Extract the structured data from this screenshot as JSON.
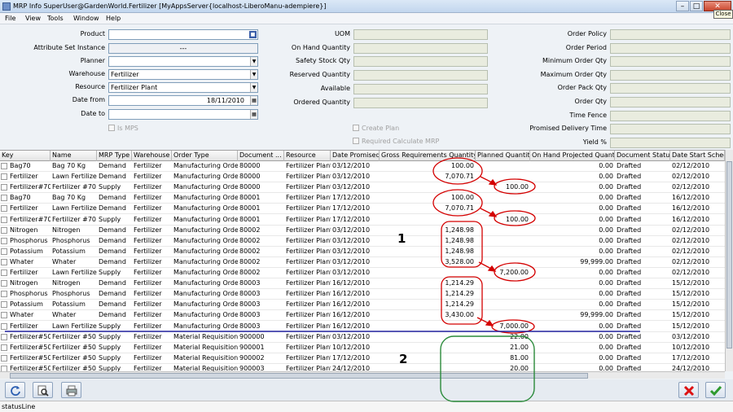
{
  "window": {
    "title": "MRP Info  SuperUser@GardenWorld.Fertilizer [MyAppsServer{localhost-LiberoManu-adempiere}]",
    "close_tooltip": "Close"
  },
  "menu": [
    "File",
    "View",
    "Tools",
    "Window",
    "Help"
  ],
  "form": {
    "left": [
      {
        "label": "Product",
        "value": "",
        "kind": "pick"
      },
      {
        "label": "Attribute Set Instance",
        "value": "---",
        "kind": "center"
      },
      {
        "label": "Planner",
        "value": "",
        "kind": "dropdown"
      },
      {
        "label": "Warehouse",
        "value": "Fertilizer",
        "kind": "dropdown"
      },
      {
        "label": "Resource",
        "value": "Fertilizer Plant",
        "kind": "dropdown"
      },
      {
        "label": "Date from",
        "value": "18/11/2010",
        "kind": "date"
      },
      {
        "label": "Date to",
        "value": "",
        "kind": "date"
      }
    ],
    "is_mps_label": "Is MPS",
    "middle": [
      {
        "label": "UOM"
      },
      {
        "label": "On Hand Quantity"
      },
      {
        "label": "Safety Stock Qty"
      },
      {
        "label": "Reserved Quantity"
      },
      {
        "label": "Available"
      },
      {
        "label": "Ordered Quantity"
      }
    ],
    "create_plan_label": "Create Plan",
    "required_calc_label": "Required Calculate MRP",
    "right": [
      {
        "label": "Order Policy"
      },
      {
        "label": "Order Period"
      },
      {
        "label": "Minimum Order Qty"
      },
      {
        "label": "Maximum Order Qty"
      },
      {
        "label": "Order Pack Qty"
      },
      {
        "label": "Order Qty"
      },
      {
        "label": "Time Fence"
      },
      {
        "label": "Promised Delivery Time"
      },
      {
        "label": "Yield %"
      }
    ]
  },
  "table": {
    "columns": [
      "Key",
      "Name",
      "MRP Type",
      "Warehouse",
      "Order Type",
      "Document ...",
      "Resource",
      "Date Promised",
      "Gross Requirements Quantity",
      "Planned Quantity",
      "On Hand Projected Quantity",
      "Document Status",
      "Date Start Schedule"
    ],
    "rows": [
      [
        "Bag70",
        "Bag 70 Kg",
        "Demand",
        "Fertilizer",
        "Manufacturing Order",
        "80000",
        "Fertilizer Plant",
        "03/12/2010",
        "100.00",
        "",
        "0.00",
        "Drafted",
        "02/12/2010"
      ],
      [
        "Fertilizer",
        "Lawn Fertilizer",
        "Demand",
        "Fertilizer",
        "Manufacturing Order",
        "80000",
        "Fertilizer Plant",
        "03/12/2010",
        "7,070.71",
        "",
        "0.00",
        "Drafted",
        "02/12/2010"
      ],
      [
        "Fertilizer#70",
        "Fertilizer #70",
        "Supply",
        "Fertilizer",
        "Manufacturing Order",
        "80000",
        "Fertilizer Plant",
        "03/12/2010",
        "",
        "100.00",
        "0.00",
        "Drafted",
        "02/12/2010"
      ],
      [
        "Bag70",
        "Bag 70 Kg",
        "Demand",
        "Fertilizer",
        "Manufacturing Order",
        "80001",
        "Fertilizer Plant",
        "17/12/2010",
        "100.00",
        "",
        "0.00",
        "Drafted",
        "16/12/2010"
      ],
      [
        "Fertilizer",
        "Lawn Fertilizer",
        "Demand",
        "Fertilizer",
        "Manufacturing Order",
        "80001",
        "Fertilizer Plant",
        "17/12/2010",
        "7,070.71",
        "",
        "0.00",
        "Drafted",
        "16/12/2010"
      ],
      [
        "Fertilizer#70",
        "Fertilizer #70",
        "Supply",
        "Fertilizer",
        "Manufacturing Order",
        "80001",
        "Fertilizer Plant",
        "17/12/2010",
        "",
        "100.00",
        "0.00",
        "Drafted",
        "16/12/2010"
      ],
      [
        "Nitrogen",
        "Nitrogen",
        "Demand",
        "Fertilizer",
        "Manufacturing Order",
        "80002",
        "Fertilizer Plant",
        "03/12/2010",
        "1,248.98",
        "",
        "0.00",
        "Drafted",
        "02/12/2010"
      ],
      [
        "Phosphorus",
        "Phosphorus",
        "Demand",
        "Fertilizer",
        "Manufacturing Order",
        "80002",
        "Fertilizer Plant",
        "03/12/2010",
        "1,248.98",
        "",
        "0.00",
        "Drafted",
        "02/12/2010"
      ],
      [
        "Potassium",
        "Potassium",
        "Demand",
        "Fertilizer",
        "Manufacturing Order",
        "80002",
        "Fertilizer Plant",
        "03/12/2010",
        "1,248.98",
        "",
        "0.00",
        "Drafted",
        "02/12/2010"
      ],
      [
        "Whater",
        "Whater",
        "Demand",
        "Fertilizer",
        "Manufacturing Order",
        "80002",
        "Fertilizer Plant",
        "03/12/2010",
        "3,528.00",
        "",
        "99,999.00",
        "Drafted",
        "02/12/2010"
      ],
      [
        "Fertilizer",
        "Lawn Fertilizer",
        "Supply",
        "Fertilizer",
        "Manufacturing Order",
        "80002",
        "Fertilizer Plant",
        "03/12/2010",
        "",
        "7,200.00",
        "0.00",
        "Drafted",
        "02/12/2010"
      ],
      [
        "Nitrogen",
        "Nitrogen",
        "Demand",
        "Fertilizer",
        "Manufacturing Order",
        "80003",
        "Fertilizer Plant",
        "16/12/2010",
        "1,214.29",
        "",
        "0.00",
        "Drafted",
        "15/12/2010"
      ],
      [
        "Phosphorus",
        "Phosphorus",
        "Demand",
        "Fertilizer",
        "Manufacturing Order",
        "80003",
        "Fertilizer Plant",
        "16/12/2010",
        "1,214.29",
        "",
        "0.00",
        "Drafted",
        "15/12/2010"
      ],
      [
        "Potassium",
        "Potassium",
        "Demand",
        "Fertilizer",
        "Manufacturing Order",
        "80003",
        "Fertilizer Plant",
        "16/12/2010",
        "1,214.29",
        "",
        "0.00",
        "Drafted",
        "15/12/2010"
      ],
      [
        "Whater",
        "Whater",
        "Demand",
        "Fertilizer",
        "Manufacturing Order",
        "80003",
        "Fertilizer Plant",
        "16/12/2010",
        "3,430.00",
        "",
        "99,999.00",
        "Drafted",
        "15/12/2010"
      ],
      [
        "Fertilizer",
        "Lawn Fertilizer",
        "Supply",
        "Fertilizer",
        "Manufacturing Order",
        "80003",
        "Fertilizer Plant",
        "16/12/2010",
        "",
        "7,000.00",
        "0.00",
        "Drafted",
        "15/12/2010"
      ],
      [
        "Fertilizer#50",
        "Fertilizer #50",
        "Supply",
        "Fertilizer",
        "Material Requisition",
        "900000",
        "Fertilizer Plant",
        "03/12/2010",
        "",
        "22.00",
        "0.00",
        "Drafted",
        "03/12/2010"
      ],
      [
        "Fertilizer#50",
        "Fertilizer #50",
        "Supply",
        "Fertilizer",
        "Material Requisition",
        "900001",
        "Fertilizer Plant",
        "10/12/2010",
        "",
        "21.00",
        "0.00",
        "Drafted",
        "10/12/2010"
      ],
      [
        "Fertilizer#50",
        "Fertilizer #50",
        "Supply",
        "Fertilizer",
        "Material Requisition",
        "900002",
        "Fertilizer Plant",
        "17/12/2010",
        "",
        "81.00",
        "0.00",
        "Drafted",
        "17/12/2010"
      ],
      [
        "Fertilizer#50",
        "Fertilizer #50",
        "Supply",
        "Fertilizer",
        "Material Requisition",
        "900003",
        "Fertilizer Plant",
        "24/12/2010",
        "",
        "20.00",
        "0.00",
        "Drafted",
        "24/12/2010"
      ]
    ]
  },
  "annotations": {
    "label_1": "1",
    "label_2": "2"
  },
  "status_line": "statusLine",
  "icons": {
    "refresh": "refresh-icon",
    "zoom": "zoom-icon",
    "print": "print-icon",
    "cancel": "cancel-icon",
    "ok": "ok-icon"
  },
  "colors": {
    "red_annotation": "#d40000",
    "green_annotation": "#2a8a3a",
    "blue_separator": "#2323a0"
  }
}
